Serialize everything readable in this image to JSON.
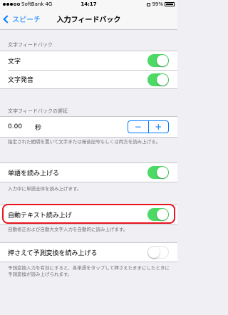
{
  "status_bar": {
    "carrier": "SoftBank",
    "network": "4G",
    "time": "14:17",
    "battery": "99%"
  },
  "nav": {
    "back_label": "スピーチ",
    "title": "入力フィードバック"
  },
  "section_text_feedback": {
    "header": "文字フィードバック",
    "rows": [
      {
        "label": "文字",
        "toggle": "on"
      },
      {
        "label": "文字発音",
        "toggle": "on"
      }
    ]
  },
  "section_delay": {
    "header": "文字フィードバックの遅延",
    "value": "0.00",
    "unit": "秒",
    "minus": "−",
    "plus": "+",
    "footer": "指定された間隔を置いて文字または発音記号もしくは両方を読み上げる。"
  },
  "section_words": {
    "label": "単語を読み上げる",
    "toggle": "on",
    "footer": "入力中に単語全体を読み上げます。"
  },
  "section_autotext": {
    "label": "自動テキスト読み上げ",
    "toggle": "on",
    "footer": "自動修正および自動大文字入力を自動的に読み上げます。"
  },
  "section_hold": {
    "label": "押さえて予測変換を読み上げる",
    "toggle": "off",
    "footer": "予測変換入力を有効にすると、各単語をタップして押さえたままにしたときに予測変換が読み上げられます。"
  },
  "colors": {
    "accent": "#007aff",
    "toggle_on": "#4cd964",
    "highlight": "#e8141e"
  }
}
